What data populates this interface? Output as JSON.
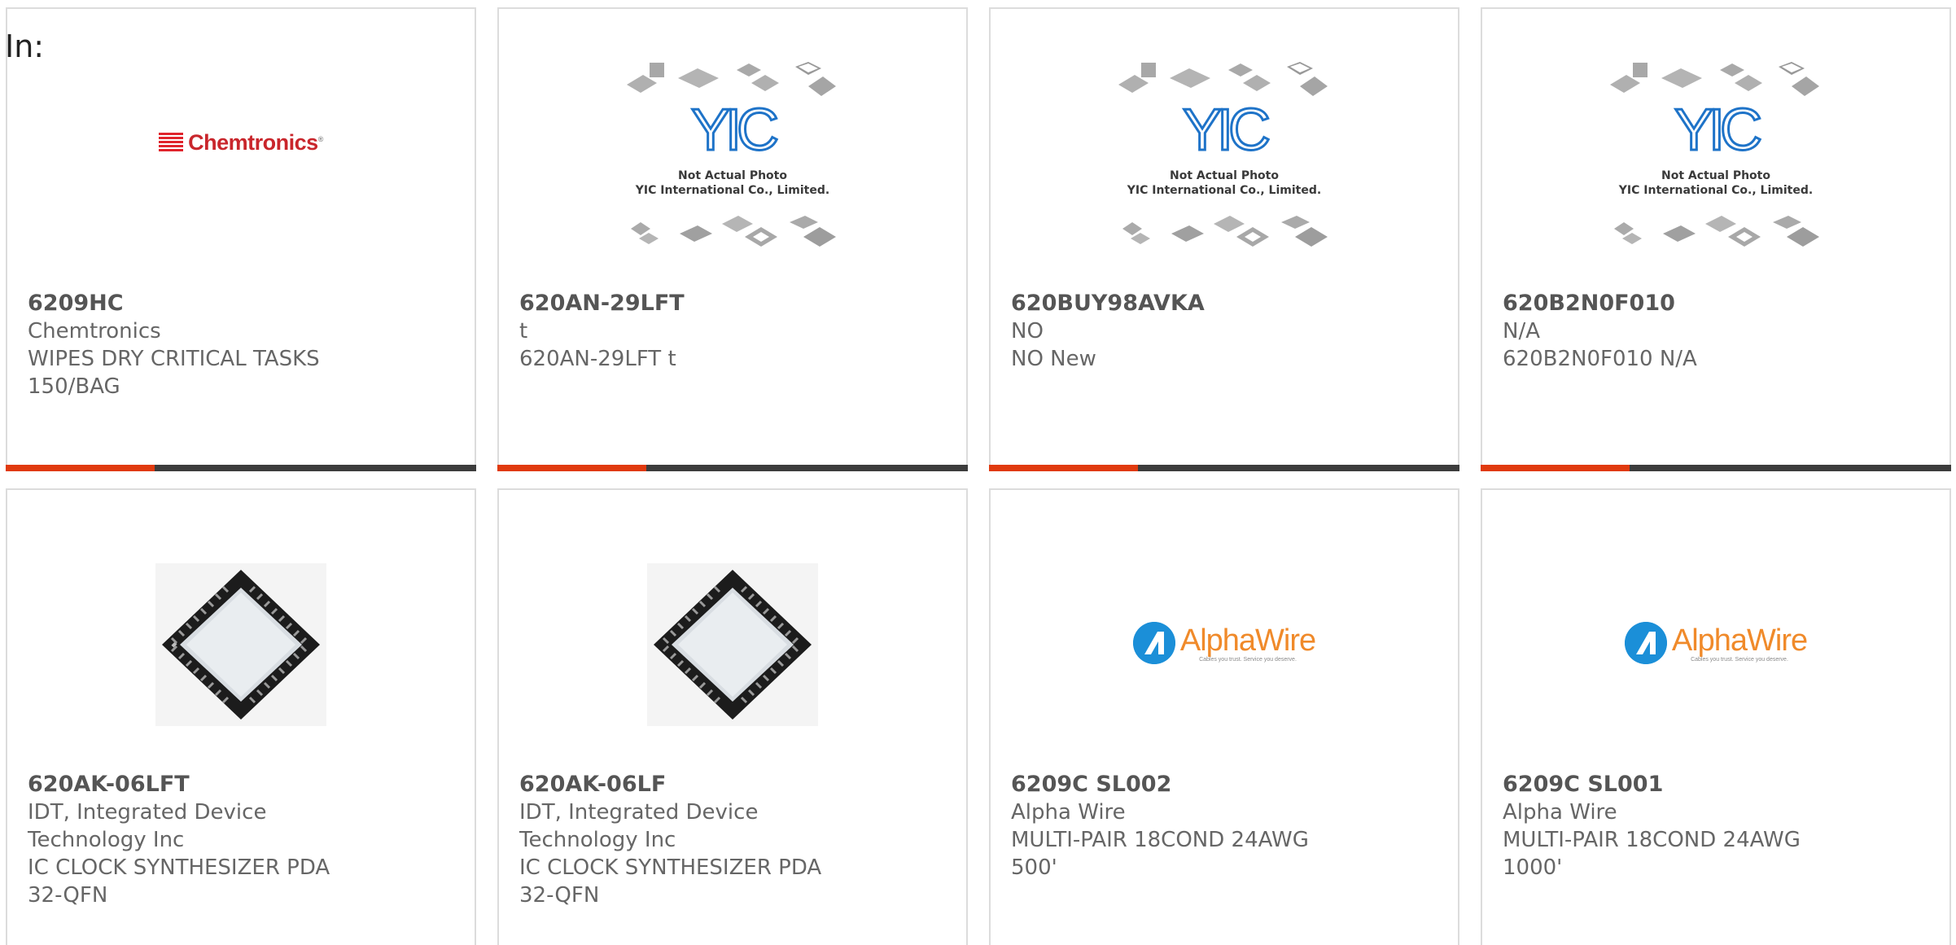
{
  "page": {
    "in_label": "In:"
  },
  "colors": {
    "accent": "#e03a0e",
    "bar": "#3c3c3c",
    "border": "#dcdcdc"
  },
  "cards": [
    {
      "part": "6209HC",
      "brand": "Chemtronics",
      "description": "WIPES DRY CRITICAL TASKS 150/BAG",
      "image": "chemtronics-logo",
      "logo_text": "Chemtronics",
      "logo_mark": "®"
    },
    {
      "part": "620AN-29LFT",
      "brand": "t",
      "description": "620AN-29LFT t",
      "image": "yic-placeholder",
      "yic_mark": "YIC",
      "caption_1": "Not Actual Photo",
      "caption_2": "YIC International Co., Limited."
    },
    {
      "part": "620BUY98AVKA",
      "brand": "NO",
      "description": "NO New",
      "image": "yic-placeholder",
      "yic_mark": "YIC",
      "caption_1": "Not Actual Photo",
      "caption_2": "YIC International Co., Limited."
    },
    {
      "part": "620B2N0F010",
      "brand": "N/A",
      "description": "620B2N0F010 N/A",
      "image": "yic-placeholder",
      "yic_mark": "YIC",
      "caption_1": "Not Actual Photo",
      "caption_2": "YIC International Co., Limited."
    },
    {
      "part": "620AK-06LFT",
      "brand": "IDT, Integrated Device Technology Inc",
      "description": "IC CLOCK SYNTHESIZER PDA 32-QFN",
      "image": "qfn-chip"
    },
    {
      "part": "620AK-06LF",
      "brand": "IDT, Integrated Device Technology Inc",
      "description": "IC CLOCK SYNTHESIZER PDA 32-QFN",
      "image": "qfn-chip"
    },
    {
      "part": "6209C SL002",
      "brand": "Alpha Wire",
      "description": "MULTI-PAIR 18COND 24AWG 500'",
      "image": "alphawire-logo",
      "logo_text": "AlphaWire",
      "logo_tagline": "Cables you trust. Service you deserve."
    },
    {
      "part": "6209C SL001",
      "brand": "Alpha Wire",
      "description": "MULTI-PAIR 18COND 24AWG 1000'",
      "image": "alphawire-logo",
      "logo_text": "AlphaWire",
      "logo_tagline": "Cables you trust. Service you deserve."
    }
  ]
}
